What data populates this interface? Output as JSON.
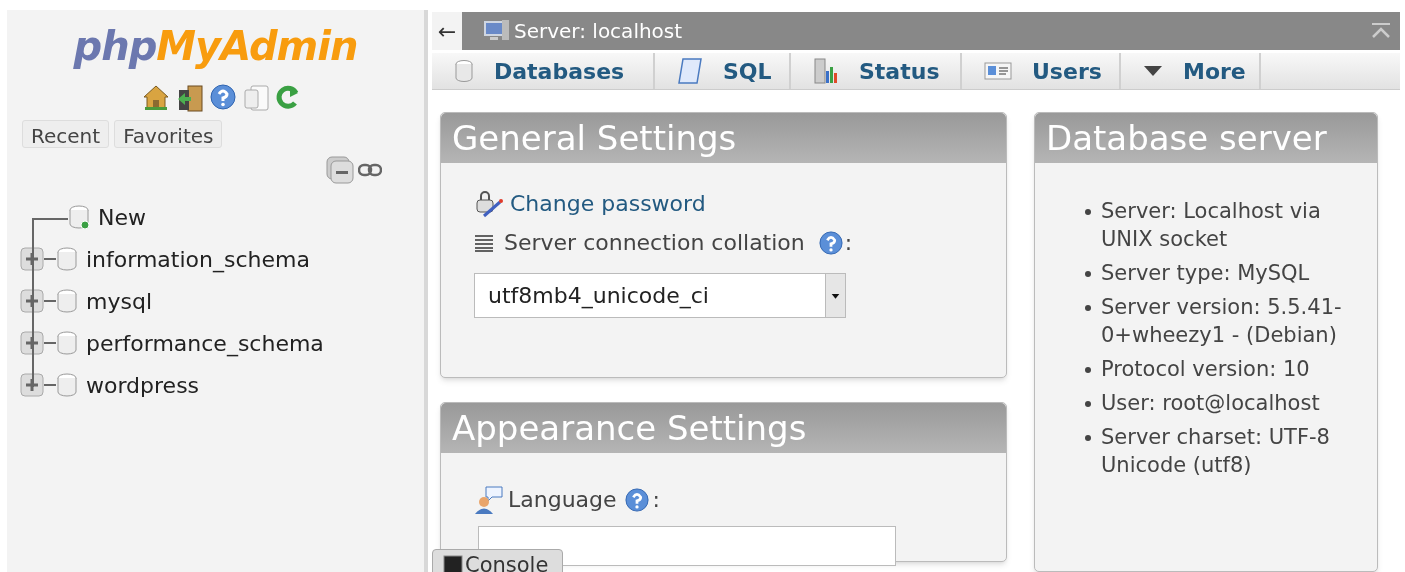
{
  "navigation": {
    "logo": {
      "part_1": "php",
      "part_2": "MyAdmin"
    },
    "tabs": [
      "Recent",
      "Favorites"
    ],
    "tree": [
      {
        "label": "New",
        "kind": "new"
      },
      {
        "label": "information_schema",
        "kind": "database"
      },
      {
        "label": "mysql",
        "kind": "database"
      },
      {
        "label": "performance_schema",
        "kind": "database"
      },
      {
        "label": "wordpress",
        "kind": "database"
      }
    ]
  },
  "breadcrumb": {
    "back": "←",
    "title": "Server: localhost"
  },
  "menu_tabs": [
    {
      "label": "Databases",
      "kind": "database"
    },
    {
      "label": "SQL",
      "kind": "sql"
    },
    {
      "label": "Status",
      "kind": "status"
    },
    {
      "label": "Users",
      "kind": "users"
    },
    {
      "label": "More",
      "kind": "more"
    }
  ],
  "general_settings": {
    "title": "General Settings",
    "change_password": "Change password",
    "collation_label": "Server connection collation",
    "suffix": ":",
    "collation_value": "utf8mb4_unicode_ci"
  },
  "appearance_settings": {
    "title": "Appearance Settings",
    "language_label": "Language",
    "suffix": ":"
  },
  "database_server": {
    "title": "Database server",
    "items": [
      "Server: Localhost via UNIX socket",
      "Server type: MySQL",
      "Server version: 5.5.41-0+wheezy1 - (Debian)",
      "Protocol version: 10",
      "User: root@localhost",
      "Server charset: UTF-8 Unicode (utf8)"
    ]
  },
  "console": {
    "label": "Console"
  }
}
